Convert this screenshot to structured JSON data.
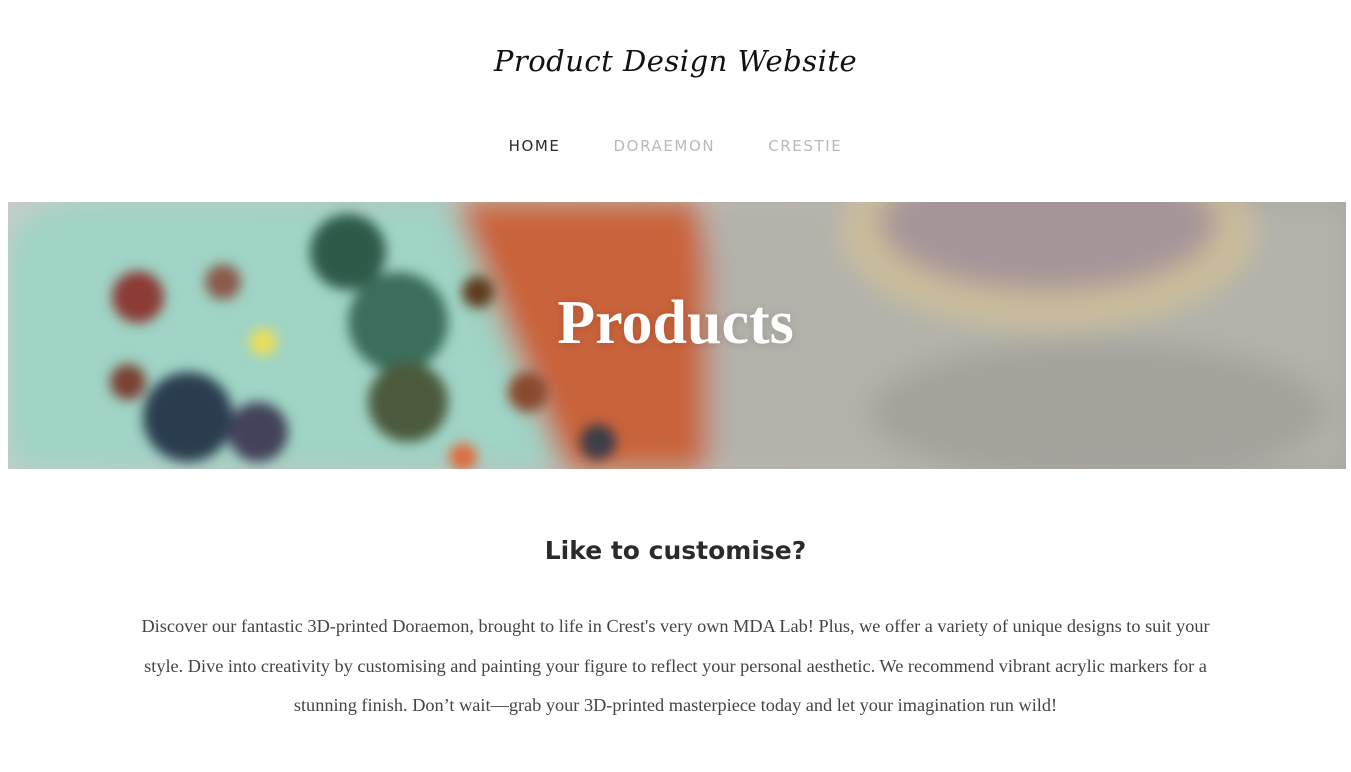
{
  "header": {
    "site_title": "Product Design Website",
    "nav": [
      {
        "label": "HOME",
        "active": true
      },
      {
        "label": "DORAEMON",
        "active": false
      },
      {
        "label": "CRESTIE",
        "active": false
      }
    ]
  },
  "banner": {
    "title": "Products"
  },
  "content": {
    "heading": "Like to customise?",
    "body": "Discover our fantastic 3D-printed Doraemon, brought to life in Crest's very own MDA Lab! Plus, we offer a variety of unique designs to suit your style. Dive into creativity by customising and painting your figure to reflect your personal aesthetic. We recommend vibrant acrylic markers for a stunning finish. Don’t wait—grab your 3D-printed masterpiece today and let your imagination run wild!"
  },
  "colors": {
    "nav_active": "#2b2b2b",
    "nav_inactive": "#b9b9b9",
    "banner_text": "#ffffff"
  }
}
